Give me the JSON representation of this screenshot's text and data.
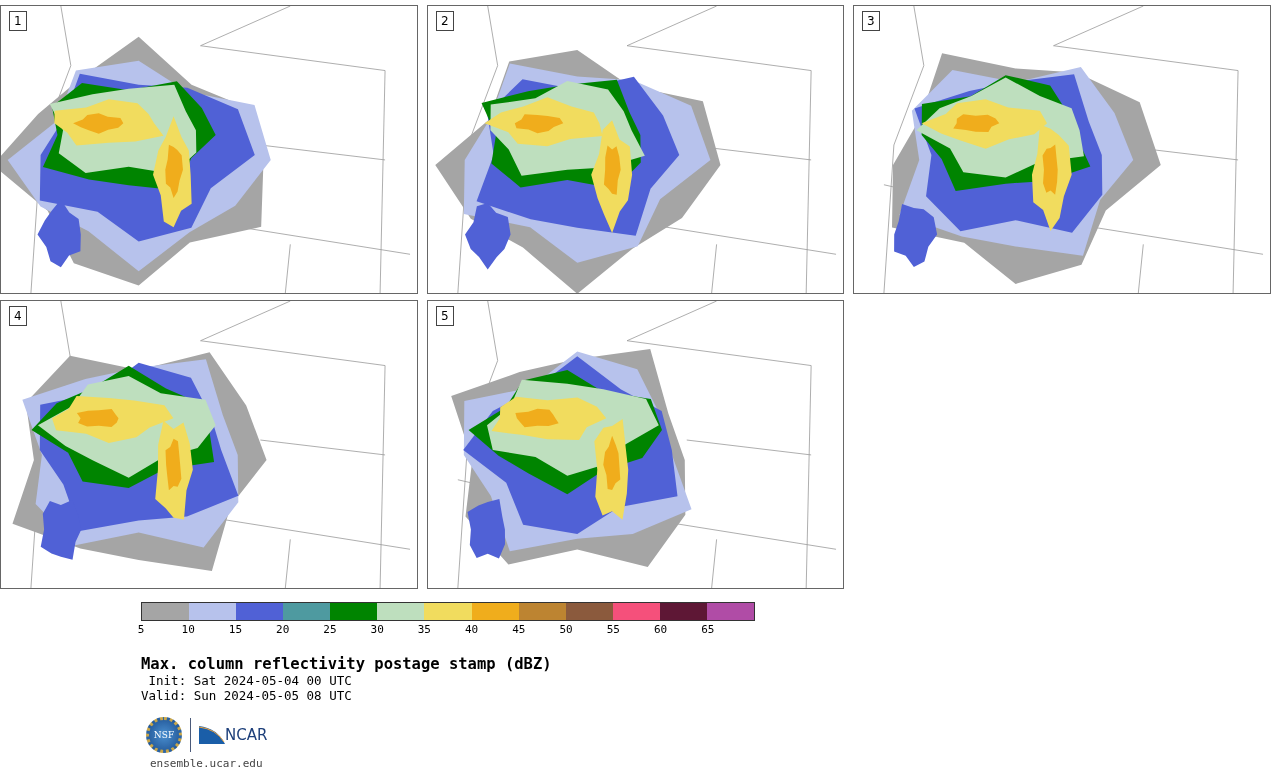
{
  "panels": [
    {
      "label": "1"
    },
    {
      "label": "2"
    },
    {
      "label": "3"
    },
    {
      "label": "4"
    },
    {
      "label": "5"
    }
  ],
  "colorbar": {
    "segments": [
      {
        "color": "#a5a5a5"
      },
      {
        "color": "#b7c2ec"
      },
      {
        "color": "#5061d6"
      },
      {
        "color": "#4e9aa0"
      },
      {
        "color": "#008400"
      },
      {
        "color": "#bedfbe"
      },
      {
        "color": "#f1dc5e"
      },
      {
        "color": "#f0ad1c"
      },
      {
        "color": "#bd8431"
      },
      {
        "color": "#8b5a3d"
      },
      {
        "color": "#f5507b"
      },
      {
        "color": "#5e1735"
      },
      {
        "color": "#b04ca6"
      }
    ],
    "ticks": [
      "5",
      "10",
      "15",
      "20",
      "25",
      "30",
      "35",
      "40",
      "45",
      "50",
      "55",
      "60",
      "65"
    ]
  },
  "title": "Max. column reflectivity postage stamp (dBZ)",
  "init": " Init: Sat 2024-05-04 00 UTC",
  "valid": "Valid: Sun 2024-05-05 08 UTC",
  "logos": {
    "nsf": "NSF",
    "ncar": "NCAR"
  },
  "website": "ensemble.ucar.edu"
}
